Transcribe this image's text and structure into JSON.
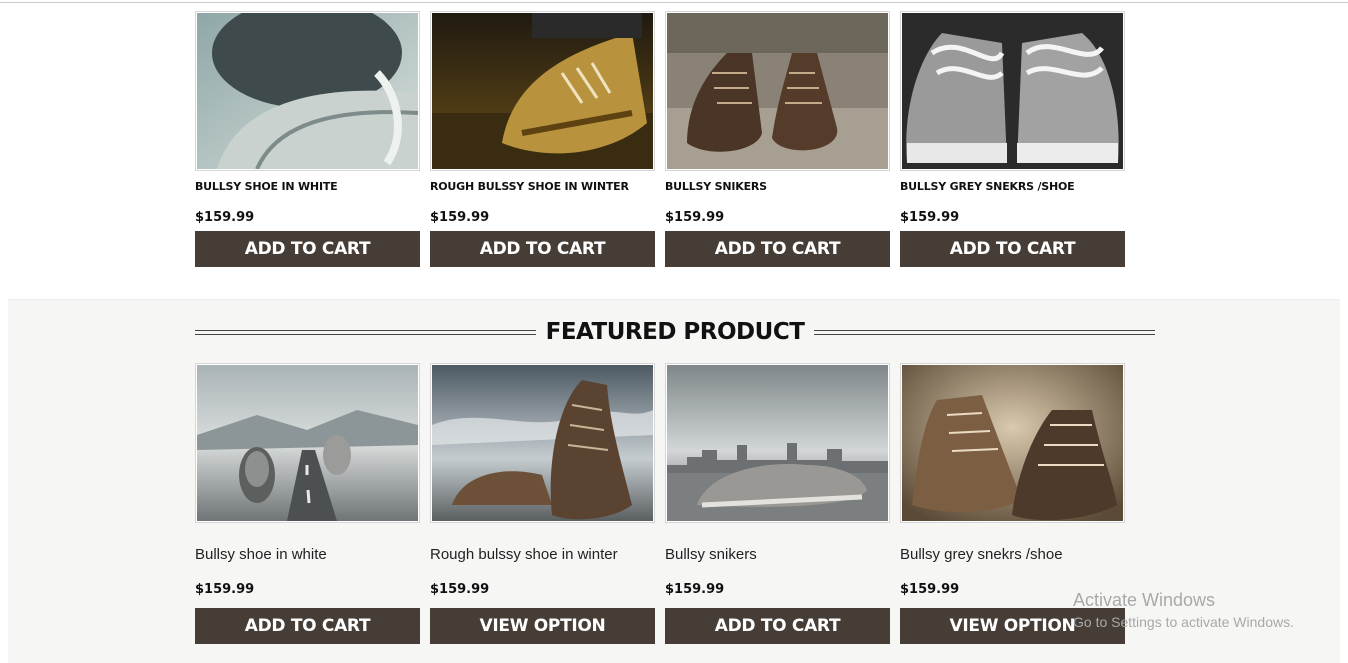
{
  "top_products": [
    {
      "name": "BULLSY SHOE IN WHITE",
      "price": "$159.99",
      "button": "ADD TO CART",
      "image": "shoe-closeup-white-photo"
    },
    {
      "name": "ROUGH BULSSY SHOE IN WINTER",
      "price": "$159.99",
      "button": "ADD TO CART",
      "image": "shoe-puddle-photo"
    },
    {
      "name": "BULLSY SNIKERS",
      "price": "$159.99",
      "button": "ADD TO CART",
      "image": "brown-boots-steps-photo"
    },
    {
      "name": "BULLSY GREY SNEKRS /SHOE",
      "price": "$159.99",
      "button": "ADD TO CART",
      "image": "grey-sneakers-photo"
    }
  ],
  "featured": {
    "title": "FEATURED PRODUCT",
    "products": [
      {
        "name": "Bullsy shoe in white",
        "price": "$159.99",
        "button": "ADD TO CART",
        "image": "shoes-on-road-photo"
      },
      {
        "name": "Rough bulssy shoe in winter",
        "price": "$159.99",
        "button": "VIEW OPTION",
        "image": "boots-cloudy-sky-photo"
      },
      {
        "name": "Bullsy snikers",
        "price": "$159.99",
        "button": "ADD TO CART",
        "image": "sneaker-city-skyline-photo"
      },
      {
        "name": "Bullsy grey snekrs /shoe",
        "price": "$159.99",
        "button": "VIEW OPTION",
        "image": "sepia-boots-photo"
      }
    ]
  },
  "watermark": {
    "line1": "Activate Windows",
    "line2": "Go to Settings to activate Windows."
  },
  "colors": {
    "button_bg": "#463d37",
    "section_bg": "#f6f6f5"
  }
}
